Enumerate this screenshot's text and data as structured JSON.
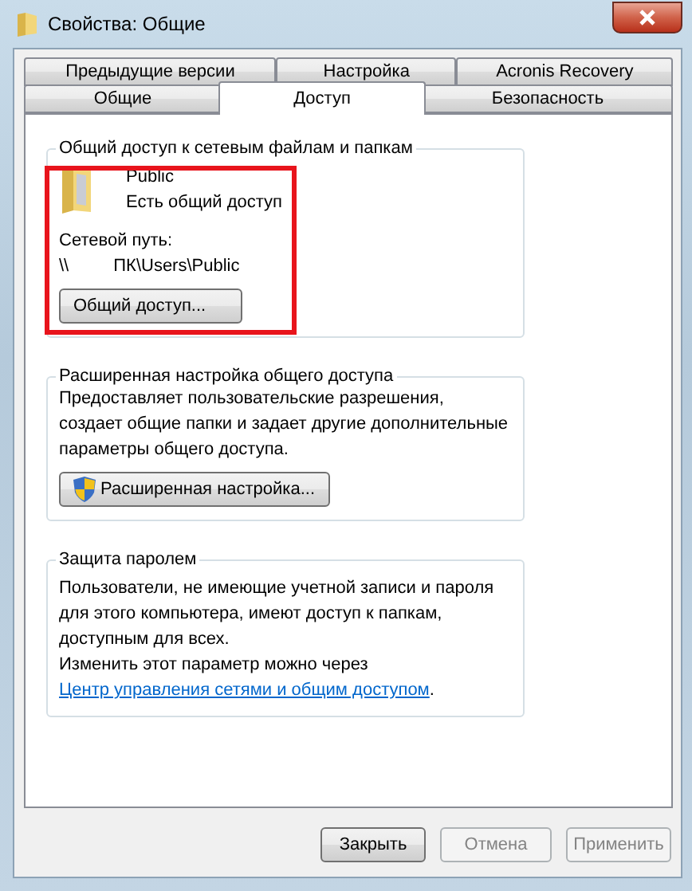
{
  "window": {
    "title": "Свойства: Общие"
  },
  "tab_rows": [
    [
      {
        "label": "Предыдущие версии",
        "selected": false
      },
      {
        "label": "Настройка",
        "selected": false
      },
      {
        "label": "Acronis Recovery",
        "selected": false
      }
    ],
    [
      {
        "label": "Общие",
        "selected": false
      },
      {
        "label": "Доступ",
        "selected": true
      },
      {
        "label": "Безопасность",
        "selected": false
      }
    ]
  ],
  "sharing": {
    "title": "Общий доступ к сетевым файлам и папкам",
    "folder_name": "Public",
    "status": "Есть общий доступ",
    "path_label": "Сетевой путь:",
    "path_prefix": "\\\\",
    "path": "ПК\\Users\\Public",
    "button": "Общий доступ...",
    "highlighted": true
  },
  "advanced": {
    "title": "Расширенная настройка общего доступа",
    "description": "Предоставляет пользовательские разрешения, создает общие папки и задает другие дополнительные параметры общего доступа.",
    "button": "Расширенная настройка..."
  },
  "password": {
    "title": "Защита паролем",
    "description": "Пользователи, не имеющие учетной записи и пароля для этого компьютера, имеют доступ к папкам, доступным для всех.",
    "change_text": "Изменить этот параметр можно через",
    "link": "Центр управления сетями и общим доступом",
    "link_end": "."
  },
  "buttons": [
    {
      "label": "Закрыть",
      "disabled": false
    },
    {
      "label": "Отмена",
      "disabled": true
    },
    {
      "label": "Применить",
      "disabled": true
    }
  ]
}
